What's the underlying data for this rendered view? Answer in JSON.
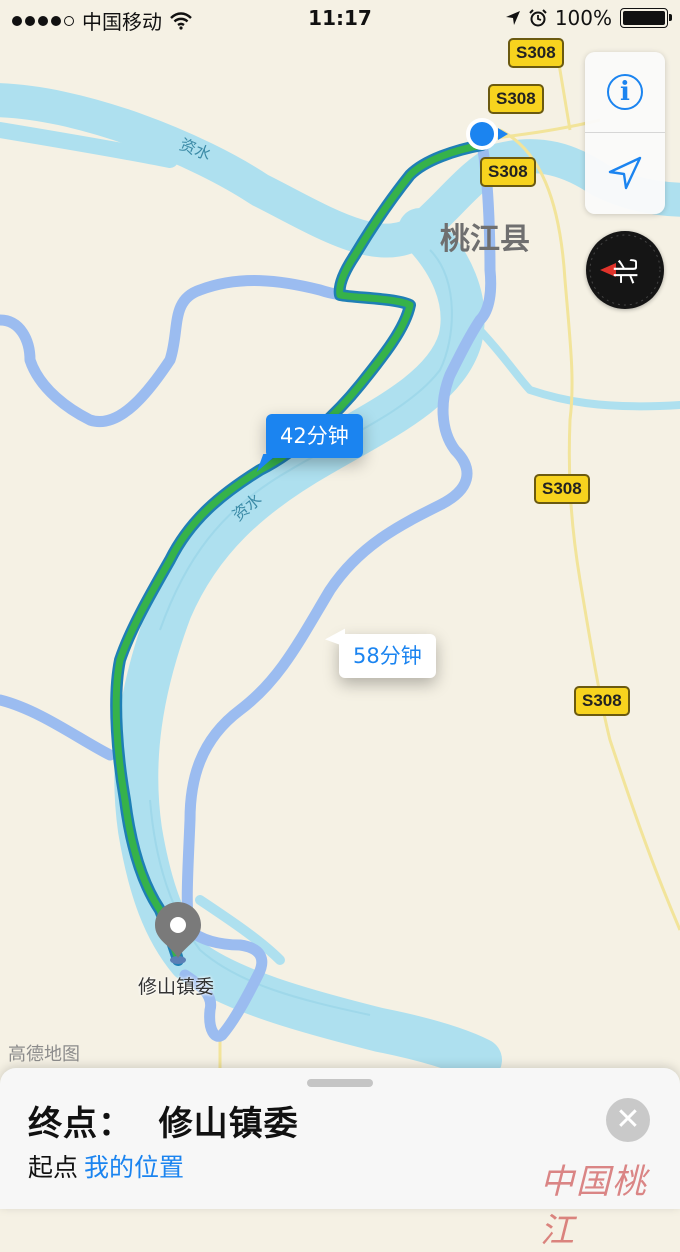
{
  "status_bar": {
    "carrier": "中国移动",
    "time": "11:17",
    "battery": "100%"
  },
  "map": {
    "road_shields": [
      "S308",
      "S308",
      "S308",
      "S308",
      "S308"
    ],
    "town_label": "桃江县",
    "river_labels": [
      "资水",
      "资水"
    ],
    "destination_label": "修山镇委",
    "compass_label": "北",
    "provider_watermark": "高德地图"
  },
  "route_callouts": {
    "primary": "42分钟",
    "alternative": "58分钟"
  },
  "bottom_sheet": {
    "destination_title": "终点：  修山镇委",
    "origin_prefix": "起点",
    "origin_value": "我的位置",
    "watermark": "中国桃江"
  },
  "colors": {
    "route_primary": "#36b24a",
    "route_alt": "#9bbcf0",
    "accent": "#1b84f0",
    "river": "#aee0ef",
    "land": "#f5f1e4"
  },
  "icons": [
    "info-icon",
    "location-arrow-icon",
    "compass-icon",
    "close-icon",
    "user-location-icon",
    "destination-pin-icon"
  ]
}
